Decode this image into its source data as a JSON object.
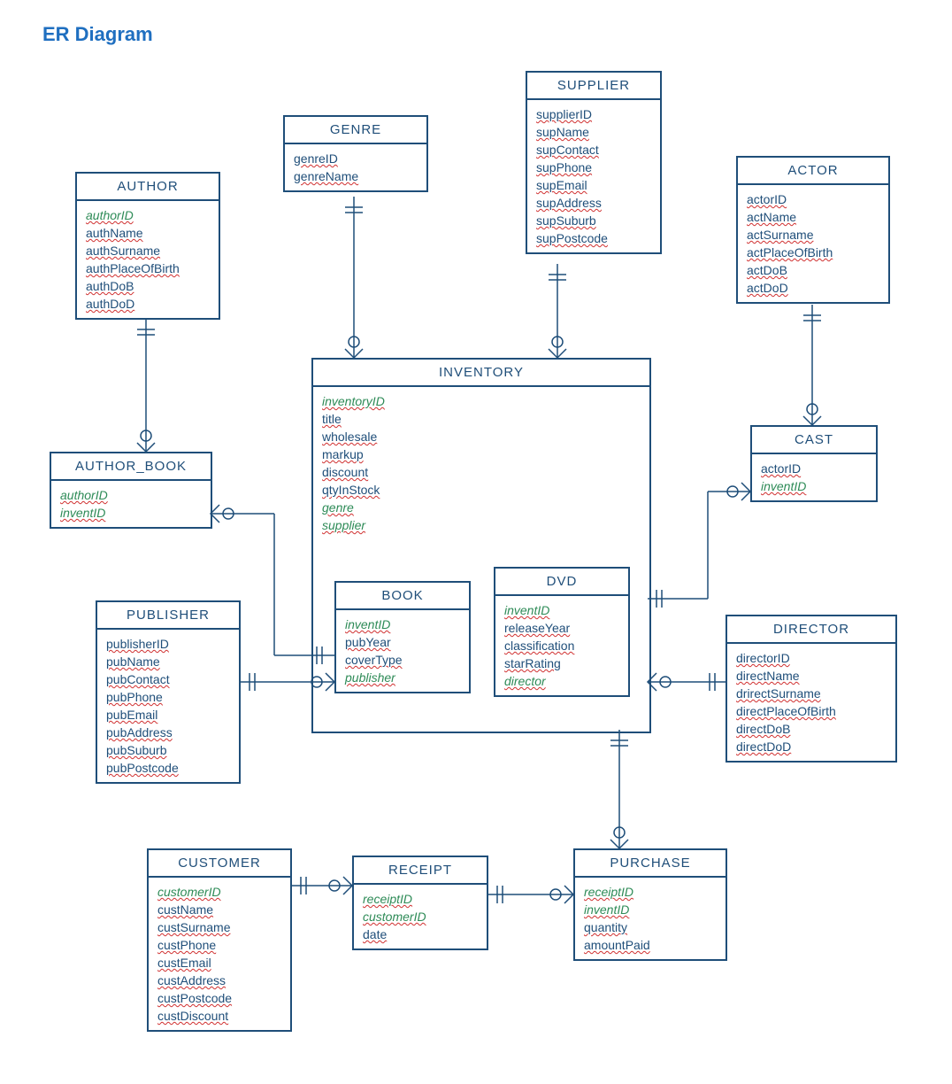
{
  "title": "ER Diagram",
  "entities": {
    "author": {
      "name": "AUTHOR",
      "attrs": [
        "authorID",
        "authName",
        "authSurname",
        "authPlaceOfBirth",
        "authDoB",
        "authDoD"
      ]
    },
    "genre": {
      "name": "GENRE",
      "attrs": [
        "genreID",
        "genreName"
      ]
    },
    "supplier": {
      "name": "SUPPLIER",
      "attrs": [
        "supplierID",
        "supName",
        "supContact",
        "supPhone",
        "supEmail",
        "supAddress",
        "supSuburb",
        "supPostcode"
      ]
    },
    "actor": {
      "name": "ACTOR",
      "attrs": [
        "actorID",
        "actName",
        "actSurname",
        "actPlaceOfBirth",
        "actDoB",
        "actDoD"
      ]
    },
    "author_book": {
      "name": "AUTHOR_BOOK",
      "attrs": [
        "authorID",
        "inventID"
      ]
    },
    "inventory": {
      "name": "INVENTORY",
      "attrs": [
        "inventoryID",
        "title",
        "wholesale",
        "markup",
        "discount",
        "qtyInStock",
        "genre",
        "supplier"
      ]
    },
    "cast": {
      "name": "CAST",
      "attrs": [
        "actorID",
        "inventID"
      ]
    },
    "publisher": {
      "name": "PUBLISHER",
      "attrs": [
        "publisherID",
        "pubName",
        "pubContact",
        "pubPhone",
        "pubEmail",
        "pubAddress",
        "pubSuburb",
        "pubPostcode"
      ]
    },
    "book": {
      "name": "BOOK",
      "attrs": [
        "inventID",
        "pubYear",
        "coverType",
        "publisher"
      ]
    },
    "dvd": {
      "name": "DVD",
      "attrs": [
        "inventID",
        "releaseYear",
        "classification",
        "starRating",
        "director"
      ]
    },
    "director": {
      "name": "DIRECTOR",
      "attrs": [
        "directorID",
        "directName",
        "drirectSurname",
        "directPlaceOfBirth",
        "directDoB",
        "directDoD"
      ]
    },
    "customer": {
      "name": "CUSTOMER",
      "attrs": [
        "customerID",
        "custName",
        "custSurname",
        "custPhone",
        "custEmail",
        "custAddress",
        "custPostcode",
        "custDiscount"
      ]
    },
    "receipt": {
      "name": "RECEIPT",
      "attrs": [
        "receiptID",
        "customerID",
        "date"
      ]
    },
    "purchase": {
      "name": "PURCHASE",
      "attrs": [
        "receiptID",
        "inventID",
        "quantity",
        "amountPaid"
      ]
    }
  },
  "fk_fields": [
    "authorID",
    "inventID",
    "genre",
    "supplier",
    "publisher",
    "director",
    "customerID",
    "receiptID",
    "inventoryID"
  ],
  "chart_data": {
    "type": "er-diagram",
    "entities": [
      {
        "name": "AUTHOR",
        "pk": [
          "authorID"
        ],
        "attrs": [
          "authorID",
          "authName",
          "authSurname",
          "authPlaceOfBirth",
          "authDoB",
          "authDoD"
        ]
      },
      {
        "name": "GENRE",
        "pk": [
          "genreID"
        ],
        "attrs": [
          "genreID",
          "genreName"
        ]
      },
      {
        "name": "SUPPLIER",
        "pk": [
          "supplierID"
        ],
        "attrs": [
          "supplierID",
          "supName",
          "supContact",
          "supPhone",
          "supEmail",
          "supAddress",
          "supSuburb",
          "supPostcode"
        ]
      },
      {
        "name": "ACTOR",
        "pk": [
          "actorID"
        ],
        "attrs": [
          "actorID",
          "actName",
          "actSurname",
          "actPlaceOfBirth",
          "actDoB",
          "actDoD"
        ]
      },
      {
        "name": "AUTHOR_BOOK",
        "pk": [
          "authorID",
          "inventID"
        ],
        "attrs": [
          "authorID",
          "inventID"
        ]
      },
      {
        "name": "INVENTORY",
        "pk": [
          "inventoryID"
        ],
        "attrs": [
          "inventoryID",
          "title",
          "wholesale",
          "markup",
          "discount",
          "qtyInStock",
          "genre",
          "supplier"
        ],
        "fk": [
          "genre",
          "supplier"
        ]
      },
      {
        "name": "CAST",
        "pk": [
          "actorID",
          "inventID"
        ],
        "attrs": [
          "actorID",
          "inventID"
        ]
      },
      {
        "name": "PUBLISHER",
        "pk": [
          "publisherID"
        ],
        "attrs": [
          "publisherID",
          "pubName",
          "pubContact",
          "pubPhone",
          "pubEmail",
          "pubAddress",
          "pubSuburb",
          "pubPostcode"
        ]
      },
      {
        "name": "BOOK",
        "pk": [
          "inventID"
        ],
        "attrs": [
          "inventID",
          "pubYear",
          "coverType",
          "publisher"
        ],
        "fk": [
          "inventID",
          "publisher"
        ]
      },
      {
        "name": "DVD",
        "pk": [
          "inventID"
        ],
        "attrs": [
          "inventID",
          "releaseYear",
          "classification",
          "starRating",
          "director"
        ],
        "fk": [
          "inventID",
          "director"
        ]
      },
      {
        "name": "DIRECTOR",
        "pk": [
          "directorID"
        ],
        "attrs": [
          "directorID",
          "directName",
          "drirectSurname",
          "directPlaceOfBirth",
          "directDoB",
          "directDoD"
        ]
      },
      {
        "name": "CUSTOMER",
        "pk": [
          "customerID"
        ],
        "attrs": [
          "customerID",
          "custName",
          "custSurname",
          "custPhone",
          "custEmail",
          "custAddress",
          "custPostcode",
          "custDiscount"
        ]
      },
      {
        "name": "RECEIPT",
        "pk": [
          "receiptID"
        ],
        "attrs": [
          "receiptID",
          "customerID",
          "date"
        ],
        "fk": [
          "customerID"
        ]
      },
      {
        "name": "PURCHASE",
        "pk": [
          "receiptID",
          "inventID"
        ],
        "attrs": [
          "receiptID",
          "inventID",
          "quantity",
          "amountPaid"
        ]
      }
    ],
    "relationships": [
      {
        "from": "AUTHOR",
        "to": "AUTHOR_BOOK",
        "cardinality": "1..* — 0..*"
      },
      {
        "from": "AUTHOR_BOOK",
        "to": "BOOK",
        "via": "inventID",
        "cardinality": "0..* — 1"
      },
      {
        "from": "GENRE",
        "to": "INVENTORY",
        "cardinality": "1 — 0..*"
      },
      {
        "from": "SUPPLIER",
        "to": "INVENTORY",
        "cardinality": "1 — 0..*"
      },
      {
        "from": "INVENTORY",
        "to": "BOOK",
        "cardinality": "1 — 1 (subtype)"
      },
      {
        "from": "INVENTORY",
        "to": "DVD",
        "cardinality": "1 — 1 (subtype)"
      },
      {
        "from": "ACTOR",
        "to": "CAST",
        "cardinality": "1 — 0..*"
      },
      {
        "from": "CAST",
        "to": "DVD",
        "cardinality": "0..* — 1"
      },
      {
        "from": "PUBLISHER",
        "to": "BOOK",
        "cardinality": "1 — 0..*"
      },
      {
        "from": "DIRECTOR",
        "to": "DVD",
        "cardinality": "1 — 0..*"
      },
      {
        "from": "DVD",
        "to": "PURCHASE",
        "via": "inventID",
        "cardinality": "1 — 0..*"
      },
      {
        "from": "CUSTOMER",
        "to": "RECEIPT",
        "cardinality": "1 — 0..*"
      },
      {
        "from": "RECEIPT",
        "to": "PURCHASE",
        "cardinality": "1 — 0..*"
      }
    ]
  }
}
